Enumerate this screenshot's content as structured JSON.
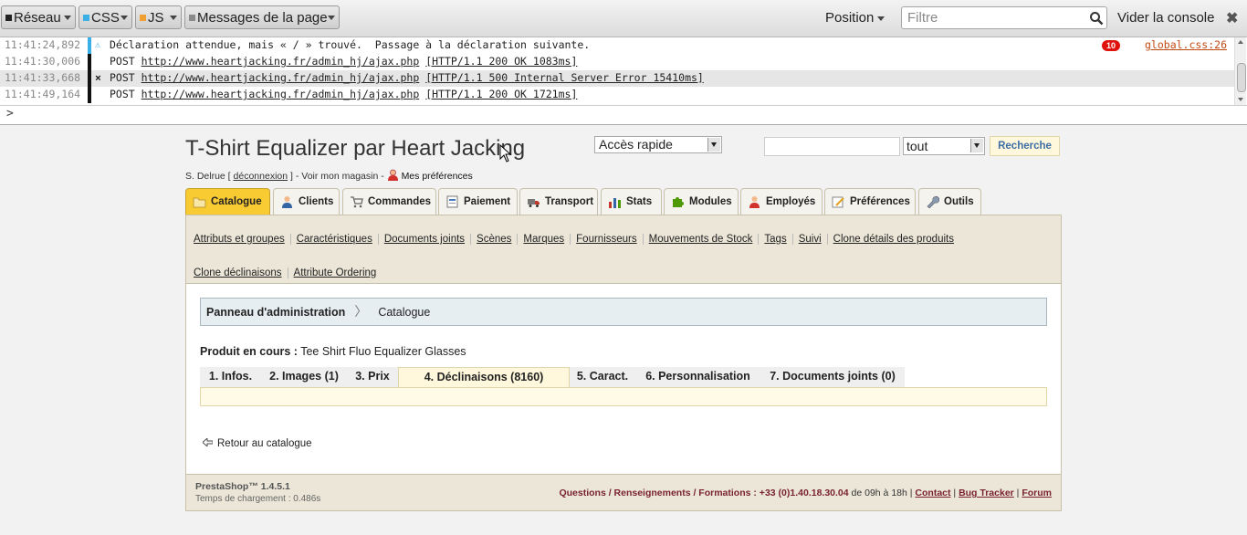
{
  "devtools": {
    "filters": [
      {
        "label": "Réseau",
        "color": "#222222"
      },
      {
        "label": "CSS",
        "color": "#3bb0e6"
      },
      {
        "label": "JS",
        "color": "#f0a030"
      },
      {
        "label": "Messages de la page",
        "color": "#8a8a8a"
      }
    ],
    "position_label": "Position",
    "filter_placeholder": "Filtre",
    "clear_label": "Vider la console",
    "close_icon": "✖",
    "prompt": ">"
  },
  "console": {
    "rows": [
      {
        "time": "11:41:24,892",
        "marker": "⚠",
        "text": "Déclaration attendue, mais « / » trouvé.  Passage à la déclaration suivante.",
        "url": "",
        "status": "",
        "bar": "#3bb0e6"
      },
      {
        "time": "11:41:30,006",
        "marker": "",
        "text": "POST ",
        "url": "http://www.heartjacking.fr/admin_hj/ajax.php",
        "status": "[HTTP/1.1 200 OK 1083ms]",
        "bar": "#111111"
      },
      {
        "time": "11:41:33,668",
        "marker": "×",
        "text": "POST ",
        "url": "http://www.heartjacking.fr/admin_hj/ajax.php",
        "status": "[HTTP/1.1 500 Internal Server Error 15410ms]",
        "bar": "#111111"
      },
      {
        "time": "11:41:49,164",
        "marker": "",
        "text": "POST ",
        "url": "http://www.heartjacking.fr/admin_hj/ajax.php",
        "status": "[HTTP/1.1 200 OK 1721ms]",
        "bar": "#111111"
      }
    ],
    "warn_count": "10",
    "source_link": "global.css:26"
  },
  "header": {
    "title": "T-Shirt Equalizer par Heart Jacking",
    "user": "S. Delrue [",
    "logout": "déconnexion",
    "after_logout": "] - Voir mon magasin -",
    "prefs": "Mes préférences",
    "quick_access": "Accès rapide",
    "search_scope": "tout",
    "search_button": "Recherche"
  },
  "tabs": [
    {
      "label": "Catalogue",
      "icon": "folder-icon",
      "active": true
    },
    {
      "label": "Clients",
      "icon": "user-icon"
    },
    {
      "label": "Commandes",
      "icon": "cart-icon"
    },
    {
      "label": "Paiement",
      "icon": "invoice-icon"
    },
    {
      "label": "Transport",
      "icon": "truck-icon"
    },
    {
      "label": "Stats",
      "icon": "chart-icon"
    },
    {
      "label": "Modules",
      "icon": "puzzle-icon"
    },
    {
      "label": "Employés",
      "icon": "employee-icon"
    },
    {
      "label": "Préférences",
      "icon": "prefs-icon"
    },
    {
      "label": "Outils",
      "icon": "wrench-icon"
    }
  ],
  "sublinks": [
    "Attributs et groupes",
    "Caractéristiques",
    "Documents joints",
    "Scènes",
    "Marques",
    "Fournisseurs",
    "Mouvements de Stock",
    "Tags",
    "Suivi",
    "Clone détails des produits",
    "Clone déclinaisons",
    "Attribute Ordering"
  ],
  "breadcrumb": {
    "root": "Panneau d'administration",
    "current": "Catalogue"
  },
  "product": {
    "label": "Produit en cours :",
    "name": "Tee Shirt Fluo Equalizer Glasses"
  },
  "product_tabs": [
    "1. Infos.",
    "2. Images (1)",
    "3. Prix",
    "4. Déclinaisons (8160)",
    "5. Caract.",
    "6. Personnalisation",
    "7. Documents joints (0)"
  ],
  "back_link": "Retour au catalogue",
  "footer": {
    "version": "PrestaShop™ 1.4.5.1",
    "load_time": "Temps de chargement : 0.486s",
    "contact_intro": "Questions / Renseignements / Formations : +33 (0)1.40.18.30.04",
    "hours": " de 09h à 18h |",
    "contact": "Contact",
    "bug": "Bug Tracker",
    "forum": "Forum"
  }
}
